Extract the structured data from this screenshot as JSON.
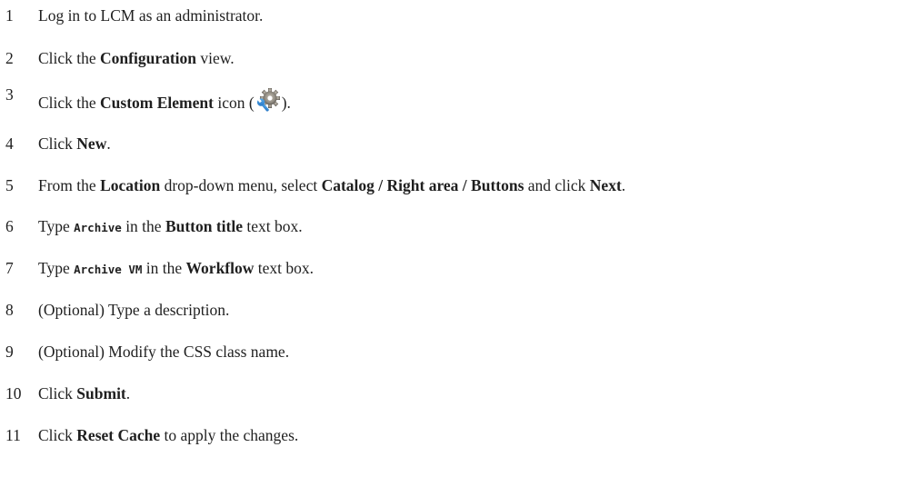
{
  "steps": [
    {
      "num": "1",
      "parts": [
        "Log in to LCM as an administrator."
      ]
    },
    {
      "num": "2",
      "parts": [
        "Click the ",
        "Configuration",
        " view."
      ]
    },
    {
      "num": "3",
      "parts": [
        "Click the ",
        "Custom Element",
        " icon (",
        ")."
      ],
      "icon": "custom-element-gear-wrench-icon"
    },
    {
      "num": "4",
      "parts": [
        "Click ",
        "New",
        "."
      ]
    },
    {
      "num": "5",
      "parts": [
        "From the ",
        "Location",
        " drop-down menu, select ",
        "Catalog / Right area / Buttons",
        " and click ",
        "Next",
        "."
      ]
    },
    {
      "num": "6",
      "parts": [
        "Type ",
        "Archive",
        " in the ",
        "Button title",
        " text box."
      ]
    },
    {
      "num": "7",
      "parts": [
        "Type ",
        "Archive VM",
        " in the ",
        "Workflow",
        " text box."
      ]
    },
    {
      "num": "8",
      "parts": [
        "(Optional) Type a description."
      ]
    },
    {
      "num": "9",
      "parts": [
        "(Optional) Modify the CSS class name."
      ]
    },
    {
      "num": "10",
      "parts": [
        "Click ",
        "Submit",
        "."
      ]
    },
    {
      "num": "11",
      "parts": [
        "Click ",
        "Reset Cache",
        " to apply the changes."
      ]
    }
  ]
}
